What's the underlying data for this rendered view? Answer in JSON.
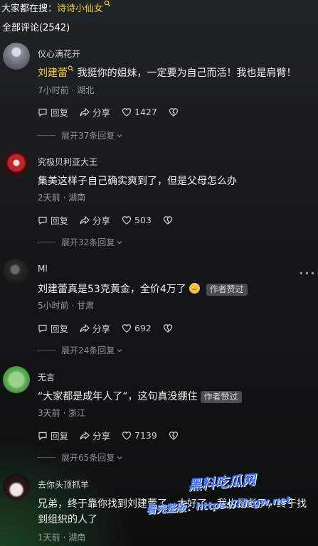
{
  "header": {
    "searching_label": "大家都在搜：",
    "search_term": "诗诗小仙女"
  },
  "total_comments": "全部评论(2542)",
  "comments": [
    {
      "user": "仪心满花开",
      "mention": "刘建蕾",
      "text": " 我挺你的姐妹，一定要为自己而活！我也是肩臂！",
      "meta": "7小时前 · 湖北",
      "reply": "回复",
      "share": "分享",
      "likes": "1427",
      "expand": "展开37条回复"
    },
    {
      "user": "究极贝利亚大王",
      "text": "集美这样子自己确实爽到了，但是父母怎么办",
      "meta": "2天前 · 湖南",
      "reply": "回复",
      "share": "分享",
      "likes": "503",
      "expand": "展开32条回复"
    },
    {
      "user": "Ml",
      "text": "刘建蕾真是53克黄金，全价4万了",
      "badge": "作者赞过",
      "meta": "5小时前 · 甘肃",
      "reply": "回复",
      "share": "分享",
      "likes": "692",
      "expand": "展开24条回复"
    },
    {
      "user": "无言",
      "text": "“大家都是成年人了”，这句真没绷住",
      "badge": "作者赞过",
      "meta": "3天前 · 浙江",
      "reply": "回复",
      "share": "分享",
      "likes": "7139",
      "expand": "展开65条回复"
    },
    {
      "user": "去你头顶抓羊",
      "text": "兄弟，终于靠你找到刘建蕾了，太好了，我也是彪子，终于找到组织的人了",
      "meta": "1天前 · 湖南"
    }
  ],
  "watermark": {
    "line1": "黑料吃瓜网",
    "line2": "看完整版：https://hlcgw.net"
  }
}
